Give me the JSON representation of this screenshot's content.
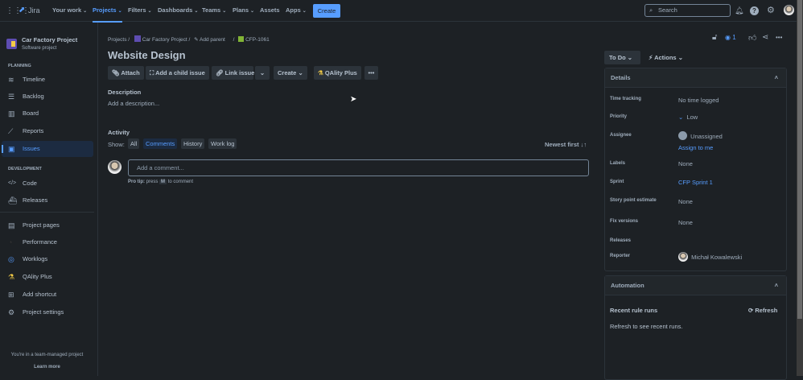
{
  "topbar": {
    "product": "Jira",
    "nav": [
      {
        "label": "Your work"
      },
      {
        "label": "Projects"
      },
      {
        "label": "Filters"
      },
      {
        "label": "Dashboards"
      },
      {
        "label": "Teams"
      },
      {
        "label": "Plans"
      },
      {
        "label": "Assets"
      },
      {
        "label": "Apps"
      }
    ],
    "create": "Create",
    "search_placeholder": "Search"
  },
  "sidebar": {
    "project_name": "Car Factory Project",
    "project_type": "Software project",
    "planning": "PLANNING",
    "development": "DEVELOPMENT",
    "planning_items": [
      {
        "label": "Timeline",
        "icon": "≋"
      },
      {
        "label": "Backlog",
        "icon": "☰"
      },
      {
        "label": "Board",
        "icon": "▥"
      },
      {
        "label": "Reports",
        "icon": "⟋"
      },
      {
        "label": "Issues",
        "icon": "▣"
      }
    ],
    "dev_items": [
      {
        "label": "Code",
        "icon": "</>"
      },
      {
        "label": "Releases",
        "icon": "⛴"
      }
    ],
    "other_items": [
      {
        "label": "Project pages",
        "icon": "▤"
      },
      {
        "label": "Performance",
        "icon": "◔"
      },
      {
        "label": "Worklogs",
        "icon": "◎"
      },
      {
        "label": "QAlity Plus",
        "icon": "⚗"
      },
      {
        "label": "Add shortcut",
        "icon": "⊞"
      },
      {
        "label": "Project settings",
        "icon": "⚙"
      }
    ],
    "footer": "You're in a team-managed project",
    "learn_more": "Learn more"
  },
  "breadcrumb": {
    "projects": "Projects",
    "project": "Car Factory Project",
    "add_parent": "Add parent",
    "issue_key": "CFP-1061"
  },
  "issue": {
    "title": "Website Design",
    "actions": {
      "attach": "Attach",
      "add_child": "Add a child issue",
      "link": "Link issue",
      "create": "Create",
      "qality": "QAlity Plus"
    },
    "description_label": "Description",
    "description_placeholder": "Add a description...",
    "activity": "Activity",
    "show": "Show:",
    "filters": [
      "All",
      "Comments",
      "History",
      "Work log"
    ],
    "sort": "Newest first",
    "comment_placeholder": "Add a comment...",
    "pro_tip": "Pro tip:",
    "press": "press",
    "key": "M",
    "to_comment": "to comment"
  },
  "right": {
    "watchers": "1",
    "status": "To Do",
    "actions": "Actions",
    "details": "Details",
    "fields": {
      "time_tracking": {
        "label": "Time tracking",
        "value": "No time logged"
      },
      "priority": {
        "label": "Priority",
        "value": "Low"
      },
      "assignee": {
        "label": "Assignee",
        "value": "Unassigned",
        "assign_me": "Assign to me"
      },
      "labels": {
        "label": "Labels",
        "value": "None"
      },
      "sprint": {
        "label": "Sprint",
        "value": "CFP Sprint 1"
      },
      "story_points": {
        "label": "Story point estimate",
        "value": "None"
      },
      "fix_versions": {
        "label": "Fix versions",
        "value": "None"
      },
      "releases": {
        "label": "Releases"
      },
      "reporter": {
        "label": "Reporter",
        "value": "Michał Kowalewski"
      }
    },
    "automation": "Automation",
    "recent_runs": "Recent rule runs",
    "refresh": "Refresh",
    "refresh_hint": "Refresh to see recent runs."
  },
  "colors": {
    "accent": "#579dff",
    "bg": "#1d2125"
  }
}
